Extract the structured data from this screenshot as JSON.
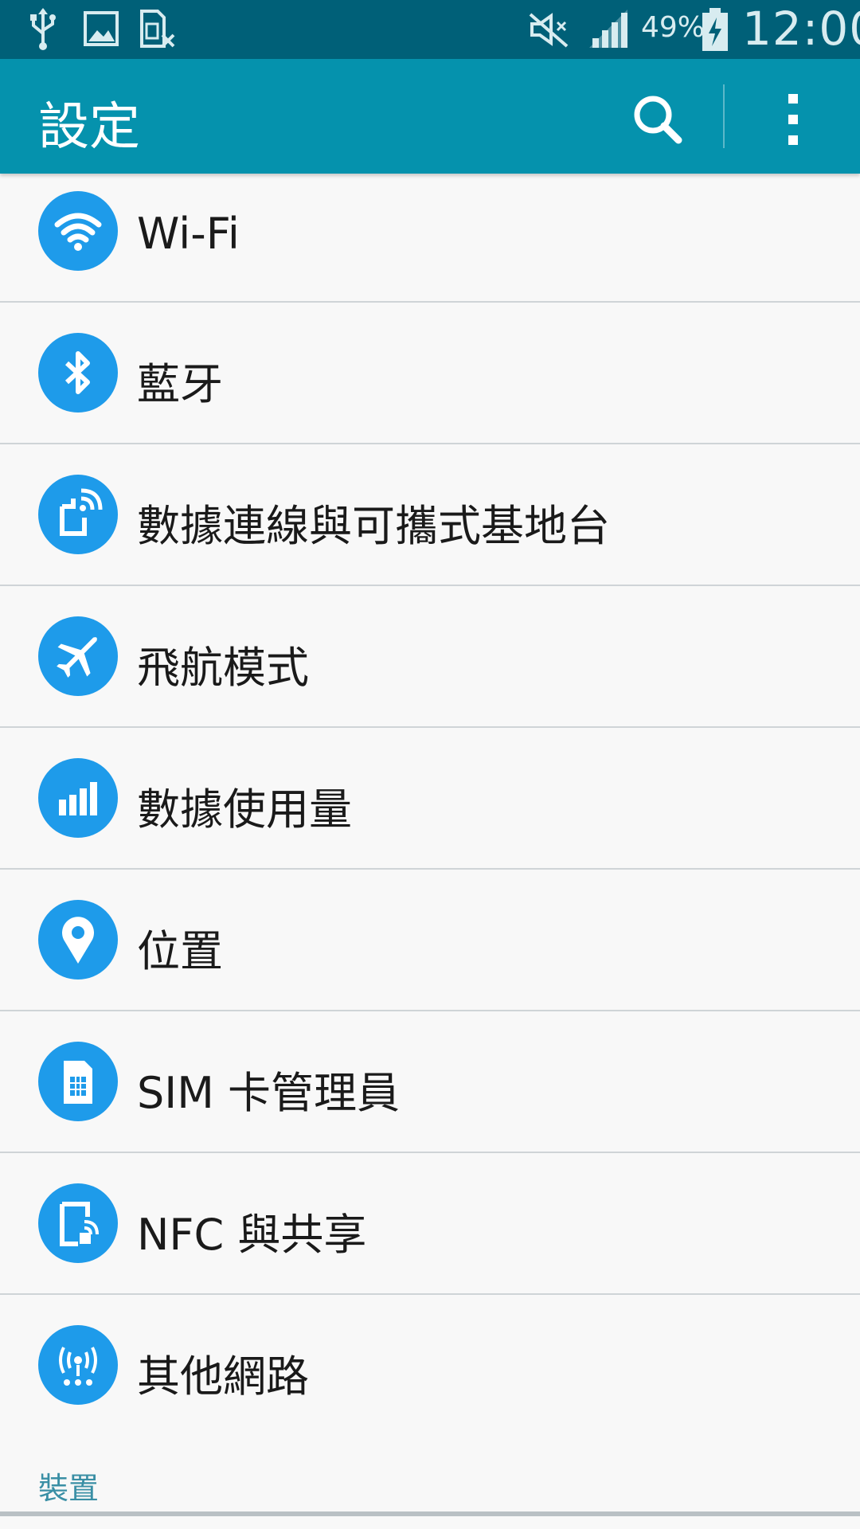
{
  "status_bar": {
    "battery_percent": "49%",
    "time": "12:00"
  },
  "app_bar": {
    "title": "設定"
  },
  "settings": [
    {
      "label": "Wi-Fi",
      "icon": "wifi-icon"
    },
    {
      "label": "藍牙",
      "icon": "bluetooth-icon"
    },
    {
      "label": "數據連線與可攜式基地台",
      "icon": "tethering-hotspot-icon"
    },
    {
      "label": "飛航模式",
      "icon": "airplane-icon"
    },
    {
      "label": "數據使用量",
      "icon": "data-usage-icon"
    },
    {
      "label": "位置",
      "icon": "location-pin-icon"
    },
    {
      "label": "SIM 卡管理員",
      "icon": "sim-card-icon"
    },
    {
      "label": "NFC 與共享",
      "icon": "nfc-share-icon"
    },
    {
      "label": "其他網路",
      "icon": "more-networks-icon"
    }
  ],
  "section_header": "裝置",
  "colors": {
    "status_bar": "#006078",
    "app_bar": "#0592ad",
    "icon_accent": "#1e9bea",
    "section_header": "#3a8fa5"
  }
}
